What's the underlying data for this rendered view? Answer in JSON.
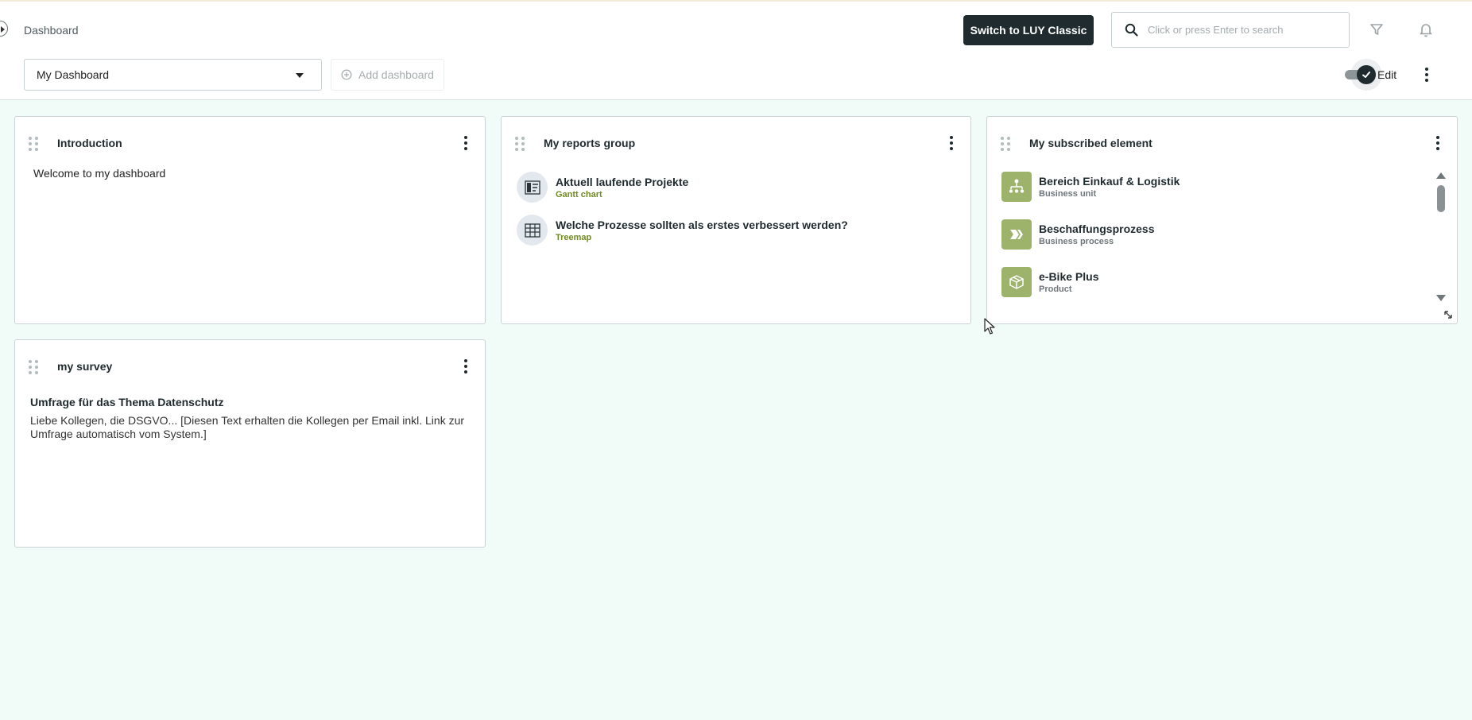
{
  "header": {
    "breadcrumb": "Dashboard",
    "switch_label": "Switch to LUY Classic",
    "search_placeholder": "Click or press Enter to search"
  },
  "toolbar": {
    "dashboard_select": "My Dashboard",
    "add_dashboard": "Add dashboard",
    "edit_label": "Edit",
    "edit_enabled": true
  },
  "widgets": {
    "introduction": {
      "title": "Introduction",
      "text": "Welcome to my dashboard"
    },
    "reports": {
      "title": "My reports group",
      "items": [
        {
          "title": "Aktuell laufende Projekte",
          "type": "Gantt chart",
          "icon": "gantt-chart-icon"
        },
        {
          "title": "Welche Prozesse sollten als erstes verbessert werden?",
          "type": "Treemap",
          "icon": "treemap-icon"
        }
      ]
    },
    "subscribed": {
      "title": "My subscribed element",
      "items": [
        {
          "title": "Bereich Einkauf & Logistik",
          "type": "Business unit",
          "icon": "business-unit-icon"
        },
        {
          "title": "Beschaffungsprozess",
          "type": "Business process",
          "icon": "business-process-icon"
        },
        {
          "title": "e-Bike Plus",
          "type": "Product",
          "icon": "product-icon"
        }
      ]
    },
    "survey": {
      "title": "my survey",
      "heading": "Umfrage für das Thema Datenschutz",
      "text": "Liebe Kollegen, die DSGVO... [Diesen Text erhalten die Kollegen per Email inkl. Link zur Umfrage automatisch vom System.]"
    }
  },
  "colors": {
    "page_background": "#f1fbf7",
    "primary_dark": "#1f2b2e",
    "report_type_text": "#708a26",
    "element_icon_bg": "#9db36b"
  }
}
